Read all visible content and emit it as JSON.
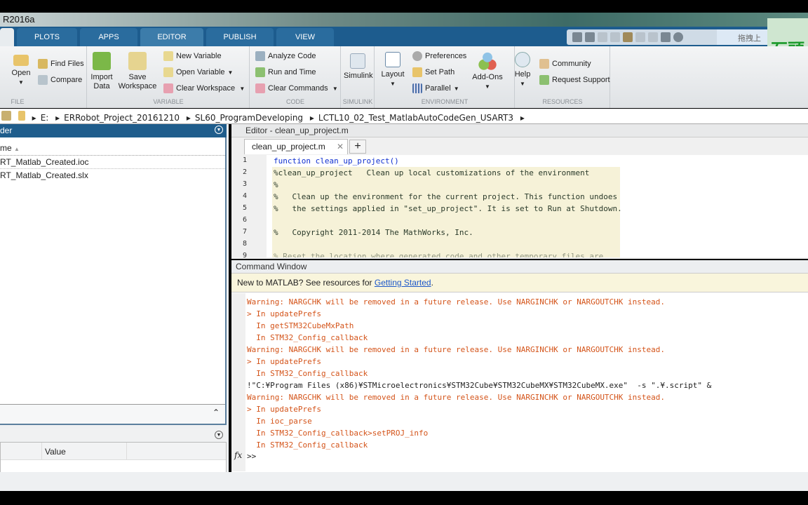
{
  "title": "R2016a",
  "tabs": [
    "PLOTS",
    "APPS",
    "EDITOR",
    "PUBLISH",
    "VIEW"
  ],
  "search_placeholder": "拖拽上",
  "overlay_text": "石頭",
  "toolstrip": {
    "file": {
      "label": "FILE",
      "open": "Open",
      "find_files": "Find Files",
      "compare": "Compare"
    },
    "variable": {
      "label": "VARIABLE",
      "import_data": "Import\nData",
      "save_workspace": "Save\nWorkspace",
      "new_variable": "New Variable",
      "open_variable": "Open Variable",
      "clear_workspace": "Clear Workspace"
    },
    "code": {
      "label": "CODE",
      "analyze": "Analyze Code",
      "run_time": "Run and Time",
      "clear_commands": "Clear Commands"
    },
    "simulink": {
      "label": "SIMULINK",
      "simulink": "Simulink"
    },
    "environment": {
      "label": "ENVIRONMENT",
      "layout": "Layout",
      "preferences": "Preferences",
      "set_path": "Set Path",
      "parallel": "Parallel",
      "addons": "Add-Ons"
    },
    "resources": {
      "label": "RESOURCES",
      "help": "Help",
      "community": "Community",
      "request_support": "Request Support"
    }
  },
  "address": [
    "E:",
    "ERRobot_Project_20161210",
    "SL60_ProgramDeveloping",
    "LCTL10_02_Test_MatlabAutoCodeGen_USART3"
  ],
  "current_folder": {
    "title": "der",
    "column": "me",
    "files": [
      "RT_Matlab_Created.ioc",
      "RT_Matlab_Created.slx"
    ]
  },
  "workspace": {
    "columns": [
      "Value"
    ]
  },
  "editor": {
    "title": "Editor - clean_up_project.m",
    "tab": "clean_up_project.m",
    "lines": [
      {
        "n": "1",
        "t": "function clean_up_project()"
      },
      {
        "n": "2",
        "t": "%clean_up_project   Clean up local customizations of the environment"
      },
      {
        "n": "3",
        "t": "%"
      },
      {
        "n": "4",
        "t": "%   Clean up the environment for the current project. This function undoes"
      },
      {
        "n": "5",
        "t": "%   the settings applied in \"set_up_project\". It is set to Run at Shutdown."
      },
      {
        "n": "6",
        "t": ""
      },
      {
        "n": "7",
        "t": "%   Copyright 2011-2014 The MathWorks, Inc."
      },
      {
        "n": "8",
        "t": ""
      },
      {
        "n": "9",
        "t": "% Reset the location where generated code and other temporary files are"
      }
    ]
  },
  "command_window": {
    "title": "Command Window",
    "banner_text": "New to MATLAB? See resources for ",
    "banner_link": "Getting Started",
    "banner_end": ".",
    "lines": [
      {
        "t": "Warning: NARGCHK will be removed in a future release. Use NARGINCHK or NARGOUTCHK instead.",
        "warn": true
      },
      {
        "t": "> In updatePrefs",
        "warn": true
      },
      {
        "t": "  In getSTM32CubeMxPath",
        "warn": true
      },
      {
        "t": "  In STM32_Config_callback",
        "warn": true
      },
      {
        "t": "Warning: NARGCHK will be removed in a future release. Use NARGINCHK or NARGOUTCHK instead.",
        "warn": true
      },
      {
        "t": "> In updatePrefs",
        "warn": true
      },
      {
        "t": "  In STM32_Config_callback",
        "warn": true
      },
      {
        "t": "!\"C:¥Program Files (x86)¥STMicroelectronics¥STM32Cube¥STM32CubeMX¥STM32CubeMX.exe\"  -s \".¥.script\" &",
        "warn": false
      },
      {
        "t": "Warning: NARGCHK will be removed in a future release. Use NARGINCHK or NARGOUTCHK instead.",
        "warn": true
      },
      {
        "t": "> In updatePrefs",
        "warn": true
      },
      {
        "t": "  In ioc_parse",
        "warn": true
      },
      {
        "t": "  In STM32_Config_callback>setPROJ_info",
        "warn": true
      },
      {
        "t": "  In STM32_Config_callback",
        "warn": true
      }
    ],
    "prompt": ">>",
    "fx": "fx"
  },
  "colors": {
    "tab_blue": "#1d5c8e",
    "warning": "#d4541a",
    "link": "#1c57c9",
    "cell_bg": "#f6f2d8"
  }
}
